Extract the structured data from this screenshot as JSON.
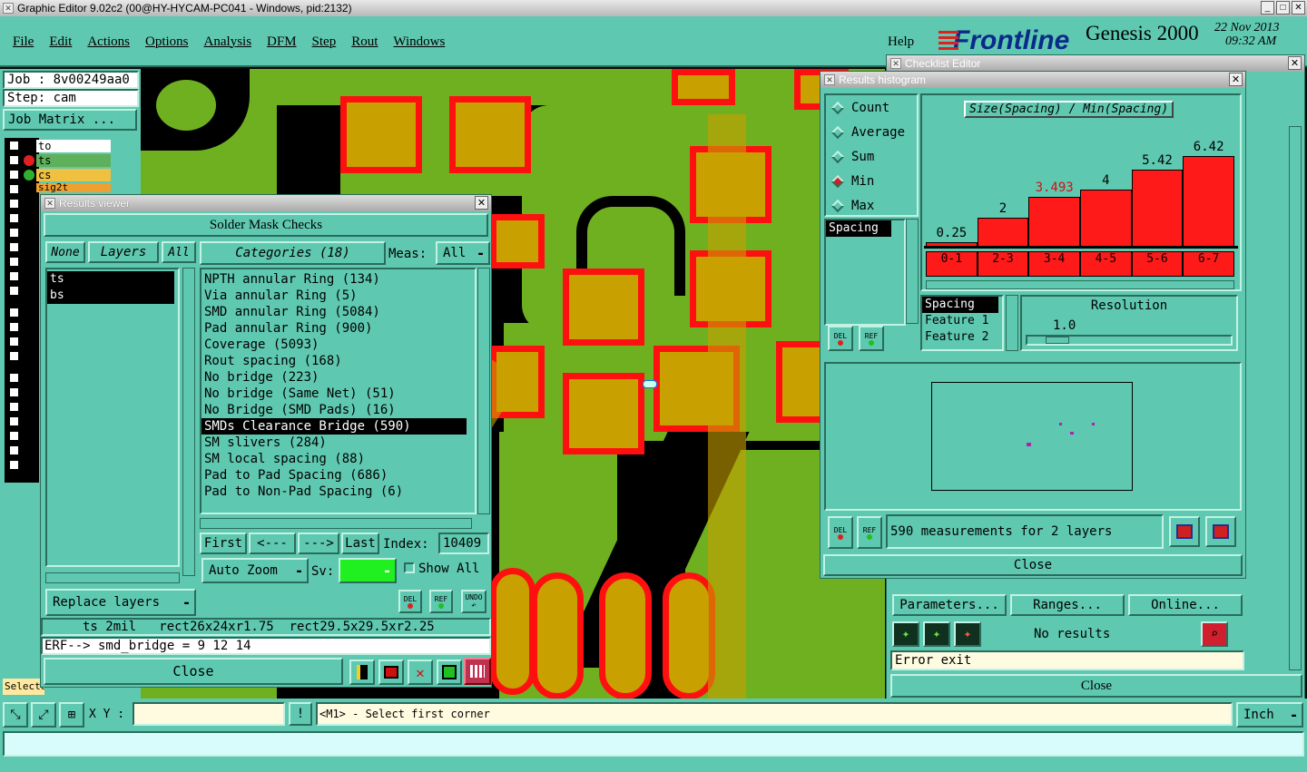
{
  "app": {
    "title": "Graphic Editor 9.02c2 (00@HY-HYCAM-PC041 - Windows, pid:2132)"
  },
  "menu": [
    "File",
    "Edit",
    "Actions",
    "Options",
    "Analysis",
    "DFM",
    "Step",
    "Rout",
    "Windows"
  ],
  "help": "Help",
  "brand": {
    "logo": "Frontline",
    "product": "Genesis 2000",
    "date": "22 Nov 2013",
    "time": "09:32 AM"
  },
  "left": {
    "job": "Job : 8v00249aa0",
    "step": "Step: cam",
    "job_matrix": "Job Matrix ...",
    "layers": [
      "to",
      "ts",
      "cs",
      "sig2t"
    ],
    "selected": "Selected"
  },
  "results_viewer": {
    "title": "Results viewer",
    "header": "Solder Mask Checks",
    "none": "None",
    "layers_label": "Layers",
    "all": "All",
    "layers": [
      "ts",
      "bs"
    ],
    "categories_label": "Categories (18)",
    "meas_label": "Meas:",
    "meas_value": "All",
    "categories": [
      "NPTH annular Ring (134)",
      "Via annular Ring (5)",
      "SMD annular Ring (5084)",
      "Pad annular Ring (900)",
      "Coverage (5093)",
      "Rout spacing (168)",
      "No bridge (223)",
      "No bridge (Same Net) (51)",
      "No Bridge (SMD Pads) (16)",
      "SMDs Clearance Bridge (590)",
      "SM slivers (284)",
      "SM local spacing (88)",
      "Pad to Pad Spacing (686)",
      "Pad to Non-Pad Spacing (6)"
    ],
    "selected_index": 9,
    "first": "First",
    "prev": "<---",
    "next": "--->",
    "last": "Last",
    "index_label": "Index:",
    "index_value": "10409",
    "auto_zoom": "Auto Zoom",
    "sv": "Sv:",
    "show_all": "Show All",
    "del": "DEL",
    "ref": "REF",
    "undo": "UNDO",
    "replace_layers": "Replace layers",
    "info": "ts 2mil   rect26x24xr1.75  rect29.5x29.5xr2.25",
    "erf": "ERF--> smd_bridge = 9 12 14",
    "close": "Close"
  },
  "histogram": {
    "title": "Results histogram",
    "modes": [
      "Count",
      "Average",
      "Sum",
      "Min",
      "Max"
    ],
    "active_mode": "Min",
    "list": [
      "Spacing"
    ],
    "chart_title": "Size(Spacing) / Min(Spacing)",
    "del": "DEL",
    "ref": "REF",
    "fields": [
      "Spacing",
      "Feature 1",
      "Feature 2"
    ],
    "resolution_label": "Resolution",
    "resolution_value": "1.0",
    "summary": "590 measurements for 2 layers",
    "close": "Close"
  },
  "chart_data": {
    "type": "bar",
    "title": "Size(Spacing) / Min(Spacing)",
    "categories": [
      "0-1",
      "2-3",
      "3-4",
      "4-5",
      "5-6",
      "6-7"
    ],
    "values": [
      0.25,
      2,
      3.493,
      4,
      5.42,
      6.42
    ],
    "value_labels": [
      "0.25",
      "2",
      "3.493",
      "4",
      "5.42",
      "6.42"
    ],
    "ylim": [
      0,
      7
    ]
  },
  "checklist": {
    "title": "Checklist Editor",
    "parameters": "Parameters...",
    "ranges": "Ranges...",
    "online": "Online...",
    "no_results": "No results",
    "error_exit": "Error exit",
    "close": "Close"
  },
  "bottom": {
    "xy": "X Y :",
    "prompt": "<M1> - Select first corner",
    "unit": "Inch"
  },
  "colors": {
    "board": "#6fb020",
    "pad": "#c8a000",
    "pad_outline": "#ff1010",
    "ui": "#5fc8b0",
    "bar": "#ff1a1a"
  }
}
